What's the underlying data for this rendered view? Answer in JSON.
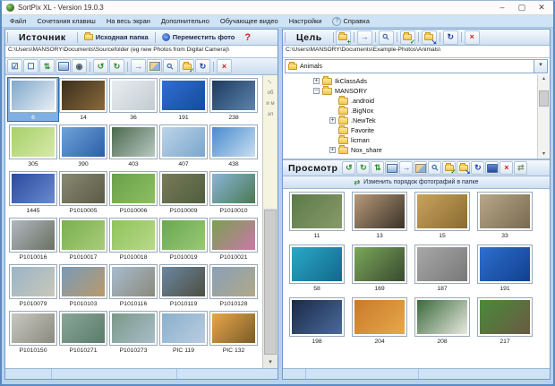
{
  "window": {
    "title": "SortPix XL - Version 19.0.3",
    "controls": {
      "minimize": "–",
      "maximize": "▢",
      "close": "✕"
    }
  },
  "menu": {
    "items": [
      "Файл",
      "Сочетания клавиш",
      "На весь экран",
      "Дополнительно",
      "Обучающее видео",
      "Настройки",
      "Справка"
    ],
    "help_badge": "?"
  },
  "colors": {
    "accent": "#2a6ab8",
    "selection": "#7fb0e4",
    "folder": "#f2c64a",
    "danger": "#d02020"
  },
  "source_panel": {
    "title": "Источник",
    "source_folder_button": "Исходная папка",
    "move_photo_button": "Переместить фото",
    "help_button": "?",
    "path": "C:\\Users\\MANSORY\\Documents\\Sourcefolder (eg new Photos from Digital Camera)\\",
    "toolbar": [
      {
        "name": "select-all-icon",
        "glyph": "☑",
        "color": "#2a6ab8"
      },
      {
        "name": "select-none-icon",
        "glyph": "☐",
        "color": "#2a6ab8"
      },
      {
        "name": "sort-order-icon",
        "glyph": "⇅",
        "color": "#2e8b2e"
      },
      {
        "name": "slideshow-icon",
        "type": "monitor"
      },
      {
        "name": "speaker-icon",
        "glyph": "◉",
        "color": "#4a5a6a"
      },
      {
        "sep": true
      },
      {
        "name": "rotate-left-icon",
        "glyph": "↺",
        "color": "#2e8b2e"
      },
      {
        "name": "rotate-right-icon",
        "glyph": "↻",
        "color": "#2e8b2e"
      },
      {
        "sep": true
      },
      {
        "name": "move-right-icon",
        "glyph": "→",
        "color": "#2a5fd0"
      },
      {
        "name": "image-icon",
        "type": "pic"
      },
      {
        "name": "zoom-icon",
        "glyph": "⚲",
        "color": "#3a6ea5",
        "cls": "rot"
      },
      {
        "name": "folder-ok-icon",
        "type": "folder",
        "overlay": "✓",
        "oc": "#1a8a1a"
      },
      {
        "name": "refresh-icon",
        "glyph": "↻",
        "color": "#2244aa"
      },
      {
        "sep": true
      },
      {
        "name": "delete-icon",
        "glyph": "×",
        "color": "#d02020"
      }
    ],
    "scroll_hint_fragments": [
      "об",
      "и м",
      "эл"
    ],
    "thumbnails": [
      {
        "label": "6",
        "c1": "#7fa8cc",
        "c2": "#e8eef4",
        "selected": true
      },
      {
        "label": "14",
        "c1": "#3a2f1e",
        "c2": "#8a6a3a"
      },
      {
        "label": "36",
        "c1": "#e9edf0",
        "c2": "#c2ccd2"
      },
      {
        "label": "191",
        "c1": "#2e6fd0",
        "c2": "#174a9e"
      },
      {
        "label": "238",
        "c1": "#1d3a5f",
        "c2": "#5d84ad"
      },
      {
        "label": "305",
        "c1": "#a8d06a",
        "c2": "#d7e9a8"
      },
      {
        "label": "390",
        "c1": "#6fa3d8",
        "c2": "#2a5fa8"
      },
      {
        "label": "403",
        "c1": "#4a6a4e",
        "c2": "#b8c8c0"
      },
      {
        "label": "407",
        "c1": "#bcd4e8",
        "c2": "#7aa6cc"
      },
      {
        "label": "438",
        "c1": "#4a8ad0",
        "c2": "#c8dff0"
      },
      {
        "label": "1445",
        "c1": "#2a4a9e",
        "c2": "#6a8ad0"
      },
      {
        "label": "P1010005",
        "c1": "#8a8a72",
        "c2": "#5a5a46"
      },
      {
        "label": "P1010006",
        "c1": "#6aa04a",
        "c2": "#8cbf62"
      },
      {
        "label": "P1010009",
        "c1": "#7a7a58",
        "c2": "#4e5e3e"
      },
      {
        "label": "P1010010",
        "c1": "#8ab4d8",
        "c2": "#4a7a52"
      },
      {
        "label": "P1010016",
        "c1": "#b0b8c0",
        "c2": "#6a7062"
      },
      {
        "label": "P1010017",
        "c1": "#7ab04e",
        "c2": "#a8cc7a"
      },
      {
        "label": "P1010018",
        "c1": "#8ec45a",
        "c2": "#b8d88a"
      },
      {
        "label": "P1010019",
        "c1": "#6aa84e",
        "c2": "#98c878"
      },
      {
        "label": "P1010021",
        "c1": "#7aa050",
        "c2": "#c878a8"
      },
      {
        "label": "P1010079",
        "c1": "#9ab4c8",
        "c2": "#c8c8b8"
      },
      {
        "label": "P1010103",
        "c1": "#7a9ab8",
        "c2": "#b89a6a"
      },
      {
        "label": "P1010116",
        "c1": "#a8bcd0",
        "c2": "#8a8a7a"
      },
      {
        "label": "P1010119",
        "c1": "#6a87a0",
        "c2": "#4e4e42"
      },
      {
        "label": "P1010128",
        "c1": "#8aa0b8",
        "c2": "#b0a888"
      },
      {
        "label": "P1010150",
        "c1": "#c8c8c0",
        "c2": "#8a8a80"
      },
      {
        "label": "P1010271",
        "c1": "#8aa89a",
        "c2": "#5a7a6a"
      },
      {
        "label": "P1010273",
        "c1": "#7a9a88",
        "c2": "#a8bcc8"
      },
      {
        "label": "PIC 119",
        "c1": "#8ab0cc",
        "c2": "#b8cce0"
      },
      {
        "label": "PIC 132",
        "c1": "#e8a84a",
        "c2": "#7a5a28"
      }
    ]
  },
  "target_panel": {
    "title": "Цель",
    "path": "C:\\Users\\MANSORY\\Documents\\Example-Photos\\Animals\\",
    "combo": {
      "value": "Animals",
      "arrow": "▾"
    },
    "toolbar": [
      {
        "name": "new-folder-icon",
        "type": "folder",
        "overlay": "+",
        "oc": "#1a8a1a"
      },
      {
        "sep": true
      },
      {
        "name": "move-right-icon",
        "glyph": "→",
        "color": "#2a5fd0"
      },
      {
        "sep": true
      },
      {
        "name": "zoom-icon",
        "glyph": "⚲",
        "color": "#3a6ea5",
        "cls": "rot"
      },
      {
        "sep": true
      },
      {
        "name": "folder-ok-icon",
        "type": "folder",
        "overlay": "✓",
        "oc": "#1a8a1a"
      },
      {
        "sep": true
      },
      {
        "name": "folder-target-icon",
        "type": "folder",
        "overlay": "↘",
        "oc": "#2244aa"
      },
      {
        "sep": true
      },
      {
        "name": "refresh-icon",
        "glyph": "↻",
        "color": "#2244aa"
      },
      {
        "sep": true
      },
      {
        "name": "delete-icon",
        "glyph": "×",
        "color": "#d02020"
      }
    ],
    "tree": [
      {
        "label": "IkClassAds",
        "level": 1,
        "exp": "+"
      },
      {
        "label": "MANSORY",
        "level": 1,
        "exp": "−"
      },
      {
        "label": ".android",
        "level": 2
      },
      {
        "label": ".BigNox",
        "level": 2
      },
      {
        "label": ".NewTek",
        "level": 2,
        "exp": "+"
      },
      {
        "label": "Favorite",
        "level": 2
      },
      {
        "label": "licman",
        "level": 2
      },
      {
        "label": "Nox_share",
        "level": 2,
        "exp": "+"
      }
    ],
    "preview": {
      "title": "Просмотр",
      "toolbar": [
        {
          "name": "rotate-left-icon",
          "glyph": "↺",
          "color": "#2e8b2e"
        },
        {
          "name": "rotate-right-icon",
          "glyph": "↻",
          "color": "#2e8b2e"
        },
        {
          "name": "sort-order-icon",
          "glyph": "⇅",
          "color": "#2e8b2e"
        },
        {
          "name": "slideshow-icon",
          "type": "monitor"
        },
        {
          "name": "move-right-icon",
          "glyph": "→",
          "color": "#2a5fd0"
        },
        {
          "name": "image-icon",
          "type": "pic"
        },
        {
          "name": "zoom-icon",
          "glyph": "⚲",
          "color": "#3a6ea5",
          "cls": "rot"
        },
        {
          "name": "folder-ok-icon",
          "type": "folder",
          "overlay": "✓",
          "oc": "#1a8a1a"
        },
        {
          "name": "folder-target-icon",
          "type": "folder",
          "overlay": "↘",
          "oc": "#2244aa"
        },
        {
          "name": "refresh-icon",
          "glyph": "↻",
          "color": "#2244aa"
        },
        {
          "name": "presentation-icon",
          "type": "monitor",
          "accent": true
        },
        {
          "name": "delete-icon",
          "glyph": "×",
          "color": "#d02020"
        },
        {
          "name": "reorder-icon",
          "glyph": "⇄",
          "color": "#7a9a7a"
        }
      ],
      "reorder_button": "Изменить порядок фотографий в папке",
      "thumbnails": [
        {
          "label": "11",
          "c1": "#5a7a48",
          "c2": "#8a9a6a"
        },
        {
          "label": "13",
          "c1": "#b89a7a",
          "c2": "#3a3228"
        },
        {
          "label": "15",
          "c1": "#c8a45a",
          "c2": "#8a6a32"
        },
        {
          "label": "33",
          "c1": "#b8a888",
          "c2": "#786a52"
        },
        {
          "label": "58",
          "c1": "#2aa8c8",
          "c2": "#12688a"
        },
        {
          "label": "169",
          "c1": "#7aa858",
          "c2": "#3a4a32"
        },
        {
          "label": "187",
          "c1": "#a8a8a8",
          "c2": "#787878"
        },
        {
          "label": "191",
          "c1": "#2e6fd0",
          "c2": "#10408e"
        },
        {
          "label": "198",
          "c1": "#1a2a48",
          "c2": "#4a6a9a"
        },
        {
          "label": "204",
          "c1": "#c87a2a",
          "c2": "#e8a84a"
        },
        {
          "label": "208",
          "c1": "#3a6a3a",
          "c2": "#e8e8e0"
        },
        {
          "label": "217",
          "c1": "#4a8a3a",
          "c2": "#6a5a42"
        }
      ]
    }
  }
}
